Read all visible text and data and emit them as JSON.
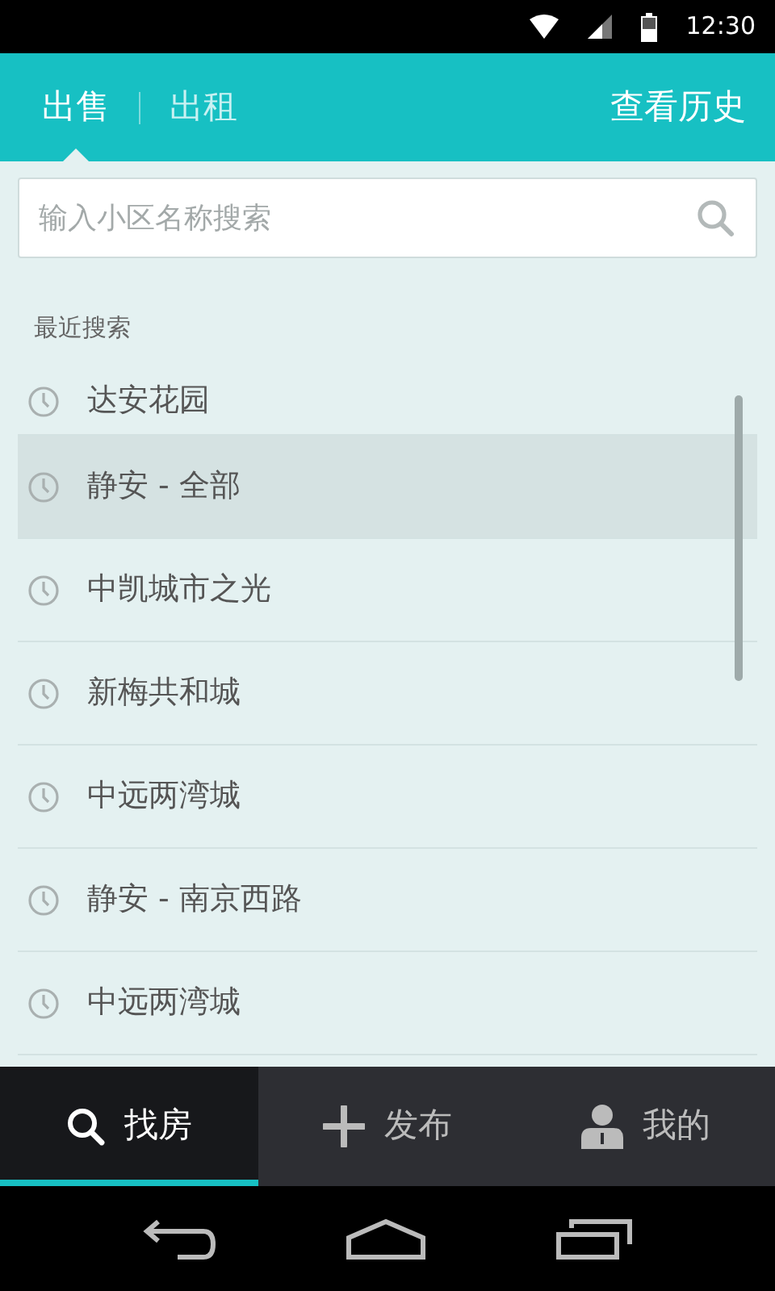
{
  "status_bar": {
    "time": "12:30"
  },
  "header": {
    "tabs": [
      {
        "label": "出售",
        "selected": true
      },
      {
        "label": "出租",
        "selected": false
      }
    ],
    "history_link": "查看历史"
  },
  "search": {
    "placeholder": "输入小区名称搜索"
  },
  "recent": {
    "title": "最近搜索",
    "items": [
      {
        "label": "达安花园",
        "selected": false
      },
      {
        "label": "静安 - 全部",
        "selected": true
      },
      {
        "label": "中凯城市之光",
        "selected": false
      },
      {
        "label": "新梅共和城",
        "selected": false
      },
      {
        "label": "中远两湾城",
        "selected": false
      },
      {
        "label": "静安 - 南京西路",
        "selected": false
      },
      {
        "label": "中远两湾城",
        "selected": false
      }
    ]
  },
  "bottom_nav": [
    {
      "kind": "search",
      "label": "找房",
      "selected": true
    },
    {
      "kind": "plus",
      "label": "发布",
      "selected": false
    },
    {
      "kind": "person",
      "label": "我的",
      "selected": false
    }
  ]
}
